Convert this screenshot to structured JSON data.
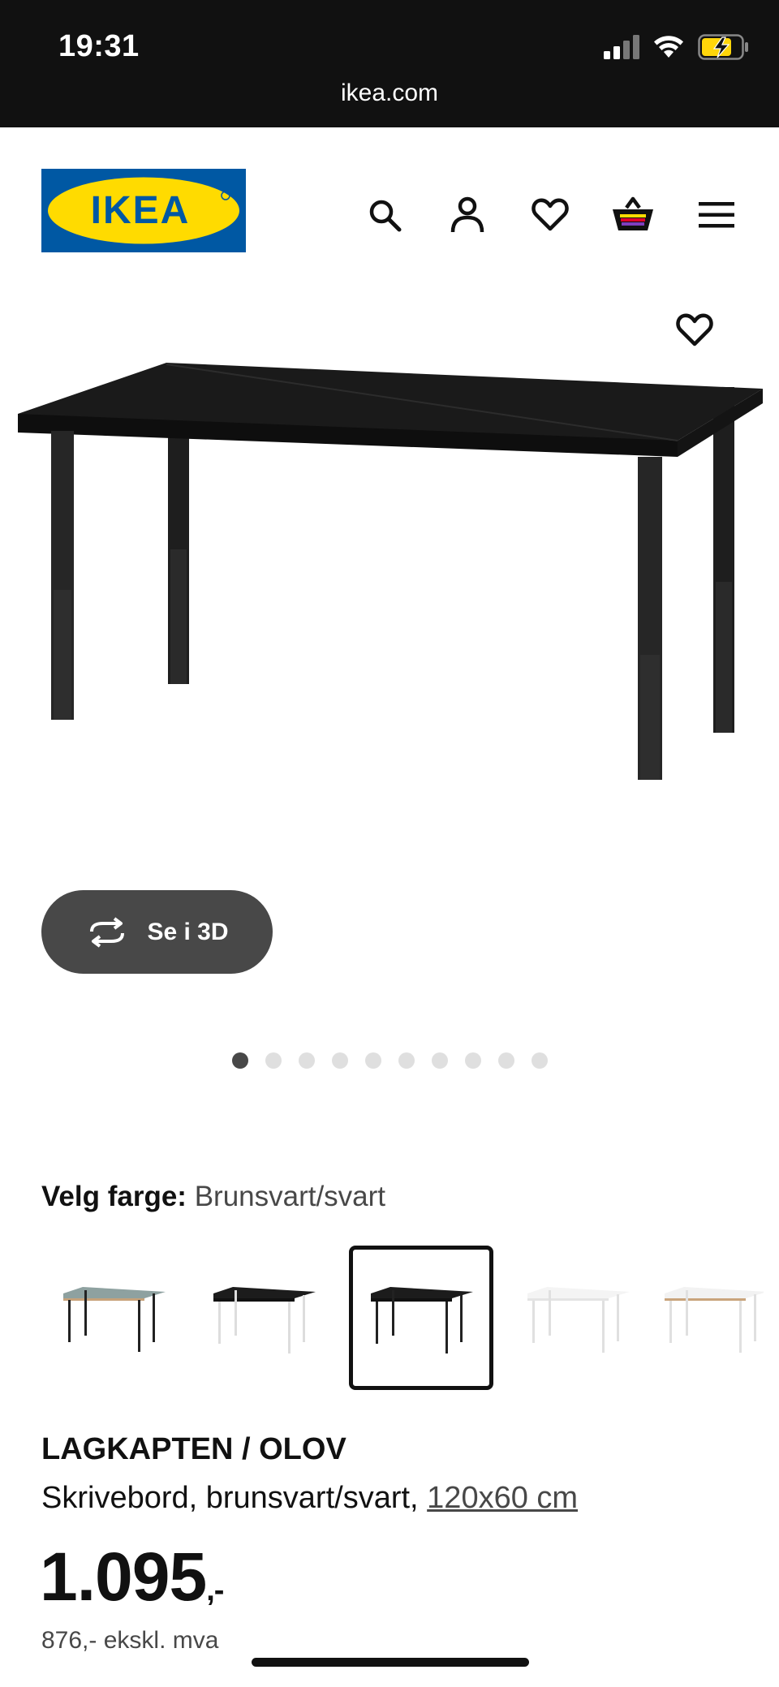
{
  "status_bar": {
    "time": "19:31",
    "url": "ikea.com"
  },
  "header": {
    "logo_text": "IKEA",
    "icons": [
      "search-icon",
      "account-icon",
      "heart-icon",
      "cart-icon",
      "menu-icon"
    ]
  },
  "hero": {
    "three_d_label": "Se i 3D",
    "image_count": 10,
    "active_image": 1
  },
  "color_choice": {
    "label": "Velg farge:",
    "value": "Brunsvart/svart",
    "swatches": [
      "grey-blue-top-black-legs",
      "black-top-white-legs",
      "black-top-black-legs",
      "white-top-white-legs",
      "white-oak-top-white-legs"
    ],
    "selected_index": 2
  },
  "product": {
    "name": "LAGKAPTEN / OLOV",
    "description": "Skrivebord, brunsvart/svart,",
    "dimensions": "120x60 cm",
    "price": "1.095",
    "price_suffix": ",-",
    "price_excl": "876,- ekskl. mva"
  },
  "colors": {
    "ikea_blue": "#0058a3",
    "ikea_yellow": "#ffdb00",
    "dark_grey": "#484848"
  }
}
